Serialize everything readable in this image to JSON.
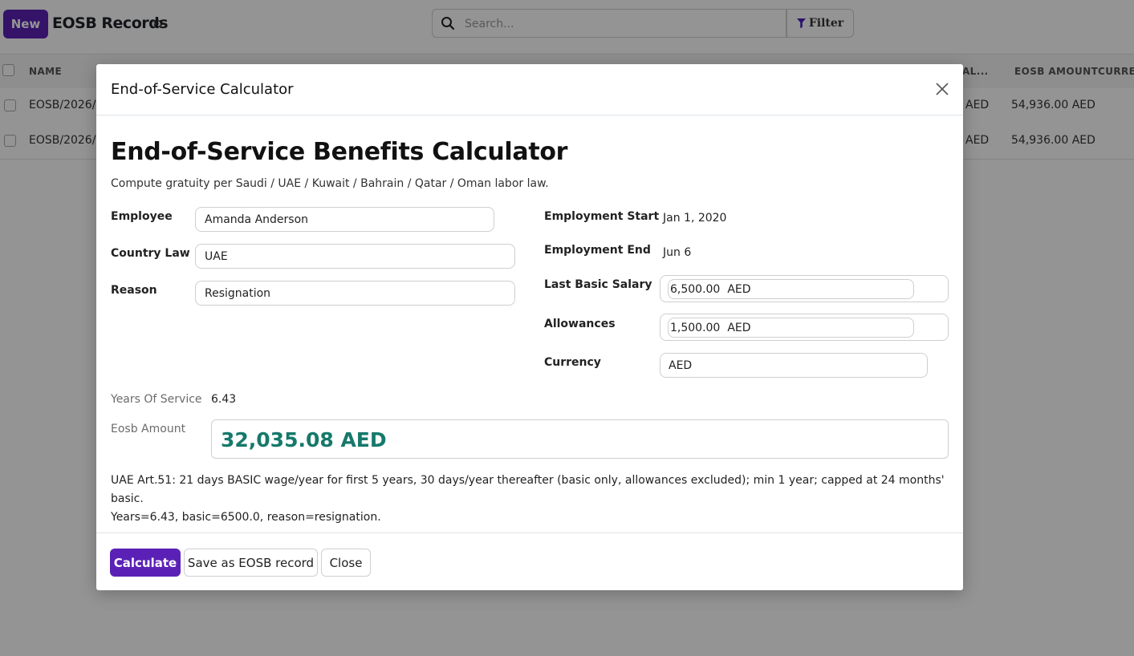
{
  "app": {
    "new_label": "New",
    "page_title": "EOSB Records",
    "search_placeholder": "Search...",
    "filter_label": "Filter"
  },
  "table": {
    "columns": [
      "NAME",
      "AL...",
      "EOSB AMOUNT",
      "CURRE"
    ],
    "rows": [
      {
        "name": "EOSB/2026/(",
        "partial": "AED",
        "eosb_amount": "54,936.00 AED"
      },
      {
        "name": "EOSB/2026/(",
        "partial": "AED",
        "eosb_amount": "54,936.00 AED"
      }
    ]
  },
  "modal": {
    "title": "End-of-Service Calculator",
    "heading": "End-of-Service Benefits Calculator",
    "subtitle": "Compute gratuity per Saudi / UAE / Kuwait / Bahrain / Qatar / Oman labor law.",
    "fields": {
      "employee_label": "Employee",
      "employee_value": "Amanda Anderson",
      "country_label": "Country Law",
      "country_value": "UAE",
      "reason_label": "Reason",
      "reason_value": "Resignation",
      "start_label": "Employment Start",
      "start_value": "Jan 1, 2020",
      "end_label": "Employment End",
      "end_value": "Jun 6",
      "salary_label": "Last Basic Salary",
      "salary_value": "6,500.00",
      "salary_currency": "AED",
      "allowances_label": "Allowances",
      "allowances_value": "1,500.00",
      "allowances_currency": "AED",
      "currency_label": "Currency",
      "currency_value": "AED"
    },
    "results": {
      "years_label": "Years Of Service",
      "years_value": "6.43",
      "amount_label": "Eosb Amount",
      "amount_value": "32,035.08 AED",
      "amount_color": "#16796b"
    },
    "note_line1": "UAE Art.51: 21 days BASIC wage/year for first 5 years, 30 days/year thereafter (basic only, allowances excluded); min 1 year; capped at 24 months' basic.",
    "note_line2": "Years=6.43, basic=6500.0, reason=resignation.",
    "buttons": {
      "calculate": "Calculate",
      "save": "Save as EOSB record",
      "close": "Close"
    }
  },
  "colors": {
    "primary": "#5b21b6",
    "accent_green": "#16796b"
  },
  "icons": {
    "settings": "gear-icon",
    "search": "search-icon",
    "filter": "filter-icon",
    "close": "close-icon"
  }
}
